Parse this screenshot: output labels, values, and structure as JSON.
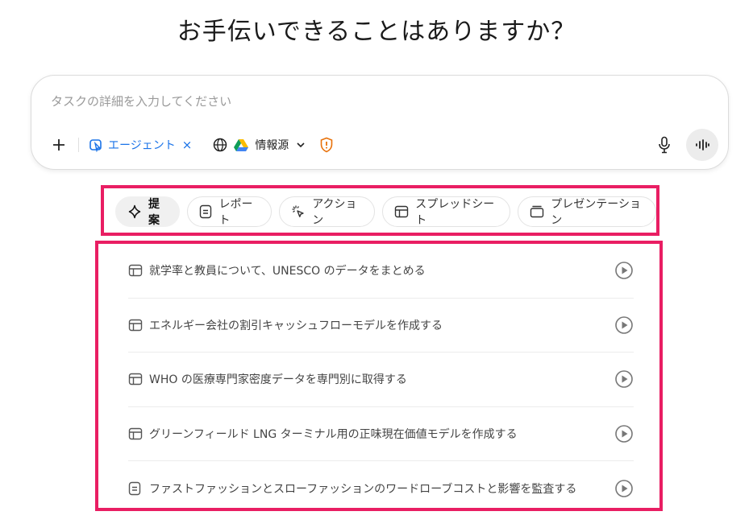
{
  "heading": "お手伝いできることはありますか？",
  "composer": {
    "placeholder": "タスクの詳細を入力してください",
    "agent_label": "エージェント",
    "agent_remove": "×",
    "source_label": "情報源",
    "accent_color": "#1a73e8",
    "icons": [
      "plus-icon",
      "agent-icon",
      "close-icon",
      "globe-icon",
      "google-drive-icon",
      "chevron-down-icon",
      "shield-alert-icon",
      "microphone-icon",
      "voice-waveform-icon"
    ]
  },
  "tabs": [
    {
      "label": "提案",
      "icon": "sparkle-icon",
      "active": true
    },
    {
      "label": "レポート",
      "icon": "document-icon",
      "active": false
    },
    {
      "label": "アクション",
      "icon": "cursor-click-icon",
      "active": false
    },
    {
      "label": "スプレッドシート",
      "icon": "table-icon",
      "active": false
    },
    {
      "label": "プレゼンテーション",
      "icon": "slides-icon",
      "active": false
    }
  ],
  "suggestions": [
    {
      "text": "就学率と教員について、UNESCO のデータをまとめる",
      "icon": "table-icon"
    },
    {
      "text": "エネルギー会社の割引キャッシュフローモデルを作成する",
      "icon": "table-icon"
    },
    {
      "text": "WHO の医療専門家密度データを専門別に取得する",
      "icon": "table-icon"
    },
    {
      "text": "グリーンフィールド LNG ターミナル用の正味現在価値モデルを作成する",
      "icon": "table-icon"
    },
    {
      "text": "ファストファッションとスローファッションのワードローブコストと影響を監査する",
      "icon": "document-icon"
    }
  ],
  "highlight_color": "#e91e63"
}
